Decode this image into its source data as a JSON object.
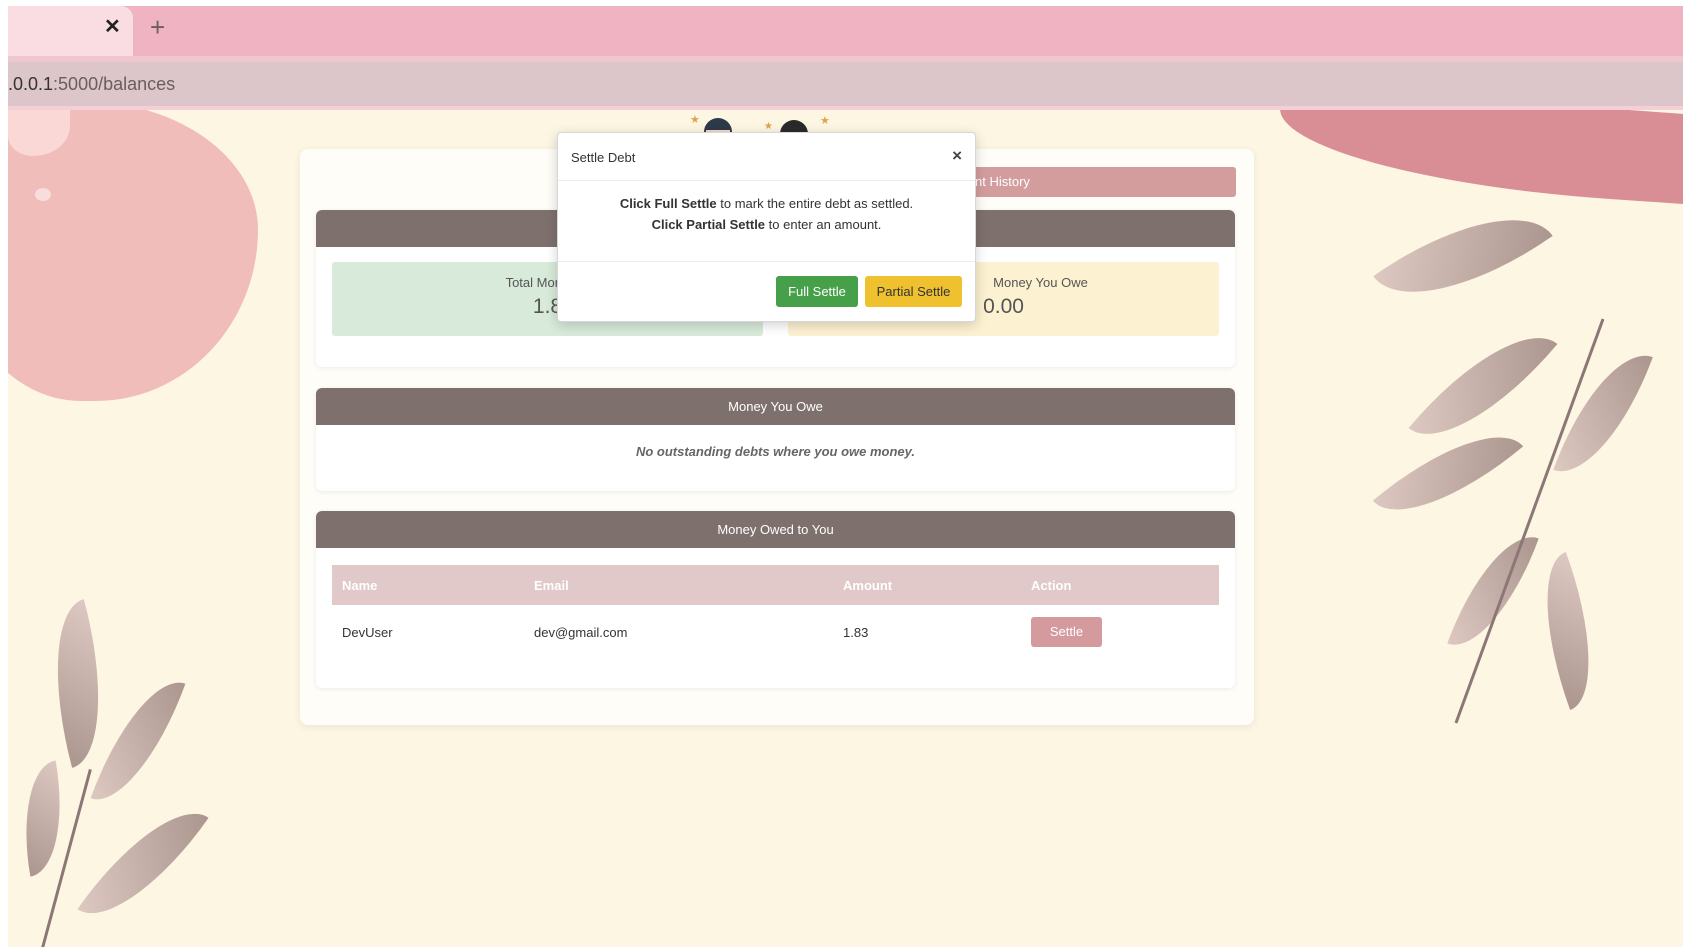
{
  "browser": {
    "url_prefix": ".0.0.1",
    "url_rest": ":5000/balances",
    "tab_close_glyph": "✕",
    "new_tab_glyph": "+"
  },
  "page": {
    "history_button_visible": "nt History",
    "summary": {
      "owed_label_visible": "Total Money O",
      "owed_value_visible": "1.8",
      "owe_label_visible": "Money You Owe",
      "owe_value": "0.00"
    },
    "money_you_owe": {
      "title": "Money You Owe",
      "empty_text": "No outstanding debts where you owe money."
    },
    "money_owed_to_you": {
      "title": "Money Owed to You",
      "columns": [
        "Name",
        "Email",
        "Amount",
        "Action"
      ],
      "rows": [
        {
          "name": "DevUser",
          "email": "dev@gmail.com",
          "amount": "1.83",
          "action": "Settle"
        }
      ]
    }
  },
  "modal": {
    "title": "Settle Debt",
    "close_glyph": "×",
    "line1_bold": "Click Full Settle",
    "line1_rest": " to mark the entire debt as settled.",
    "line2_bold": "Click Partial Settle",
    "line2_rest": " to enter an amount.",
    "full_settle_label": "Full Settle",
    "partial_settle_label": "Partial Settle"
  },
  "colors": {
    "tab_strip": "#efb3c1",
    "page_bg": "#fdf6e3",
    "section_header": "#7e706d",
    "full_settle": "#46a049",
    "partial_settle": "#efc12f",
    "settle": "#d59a9d"
  }
}
